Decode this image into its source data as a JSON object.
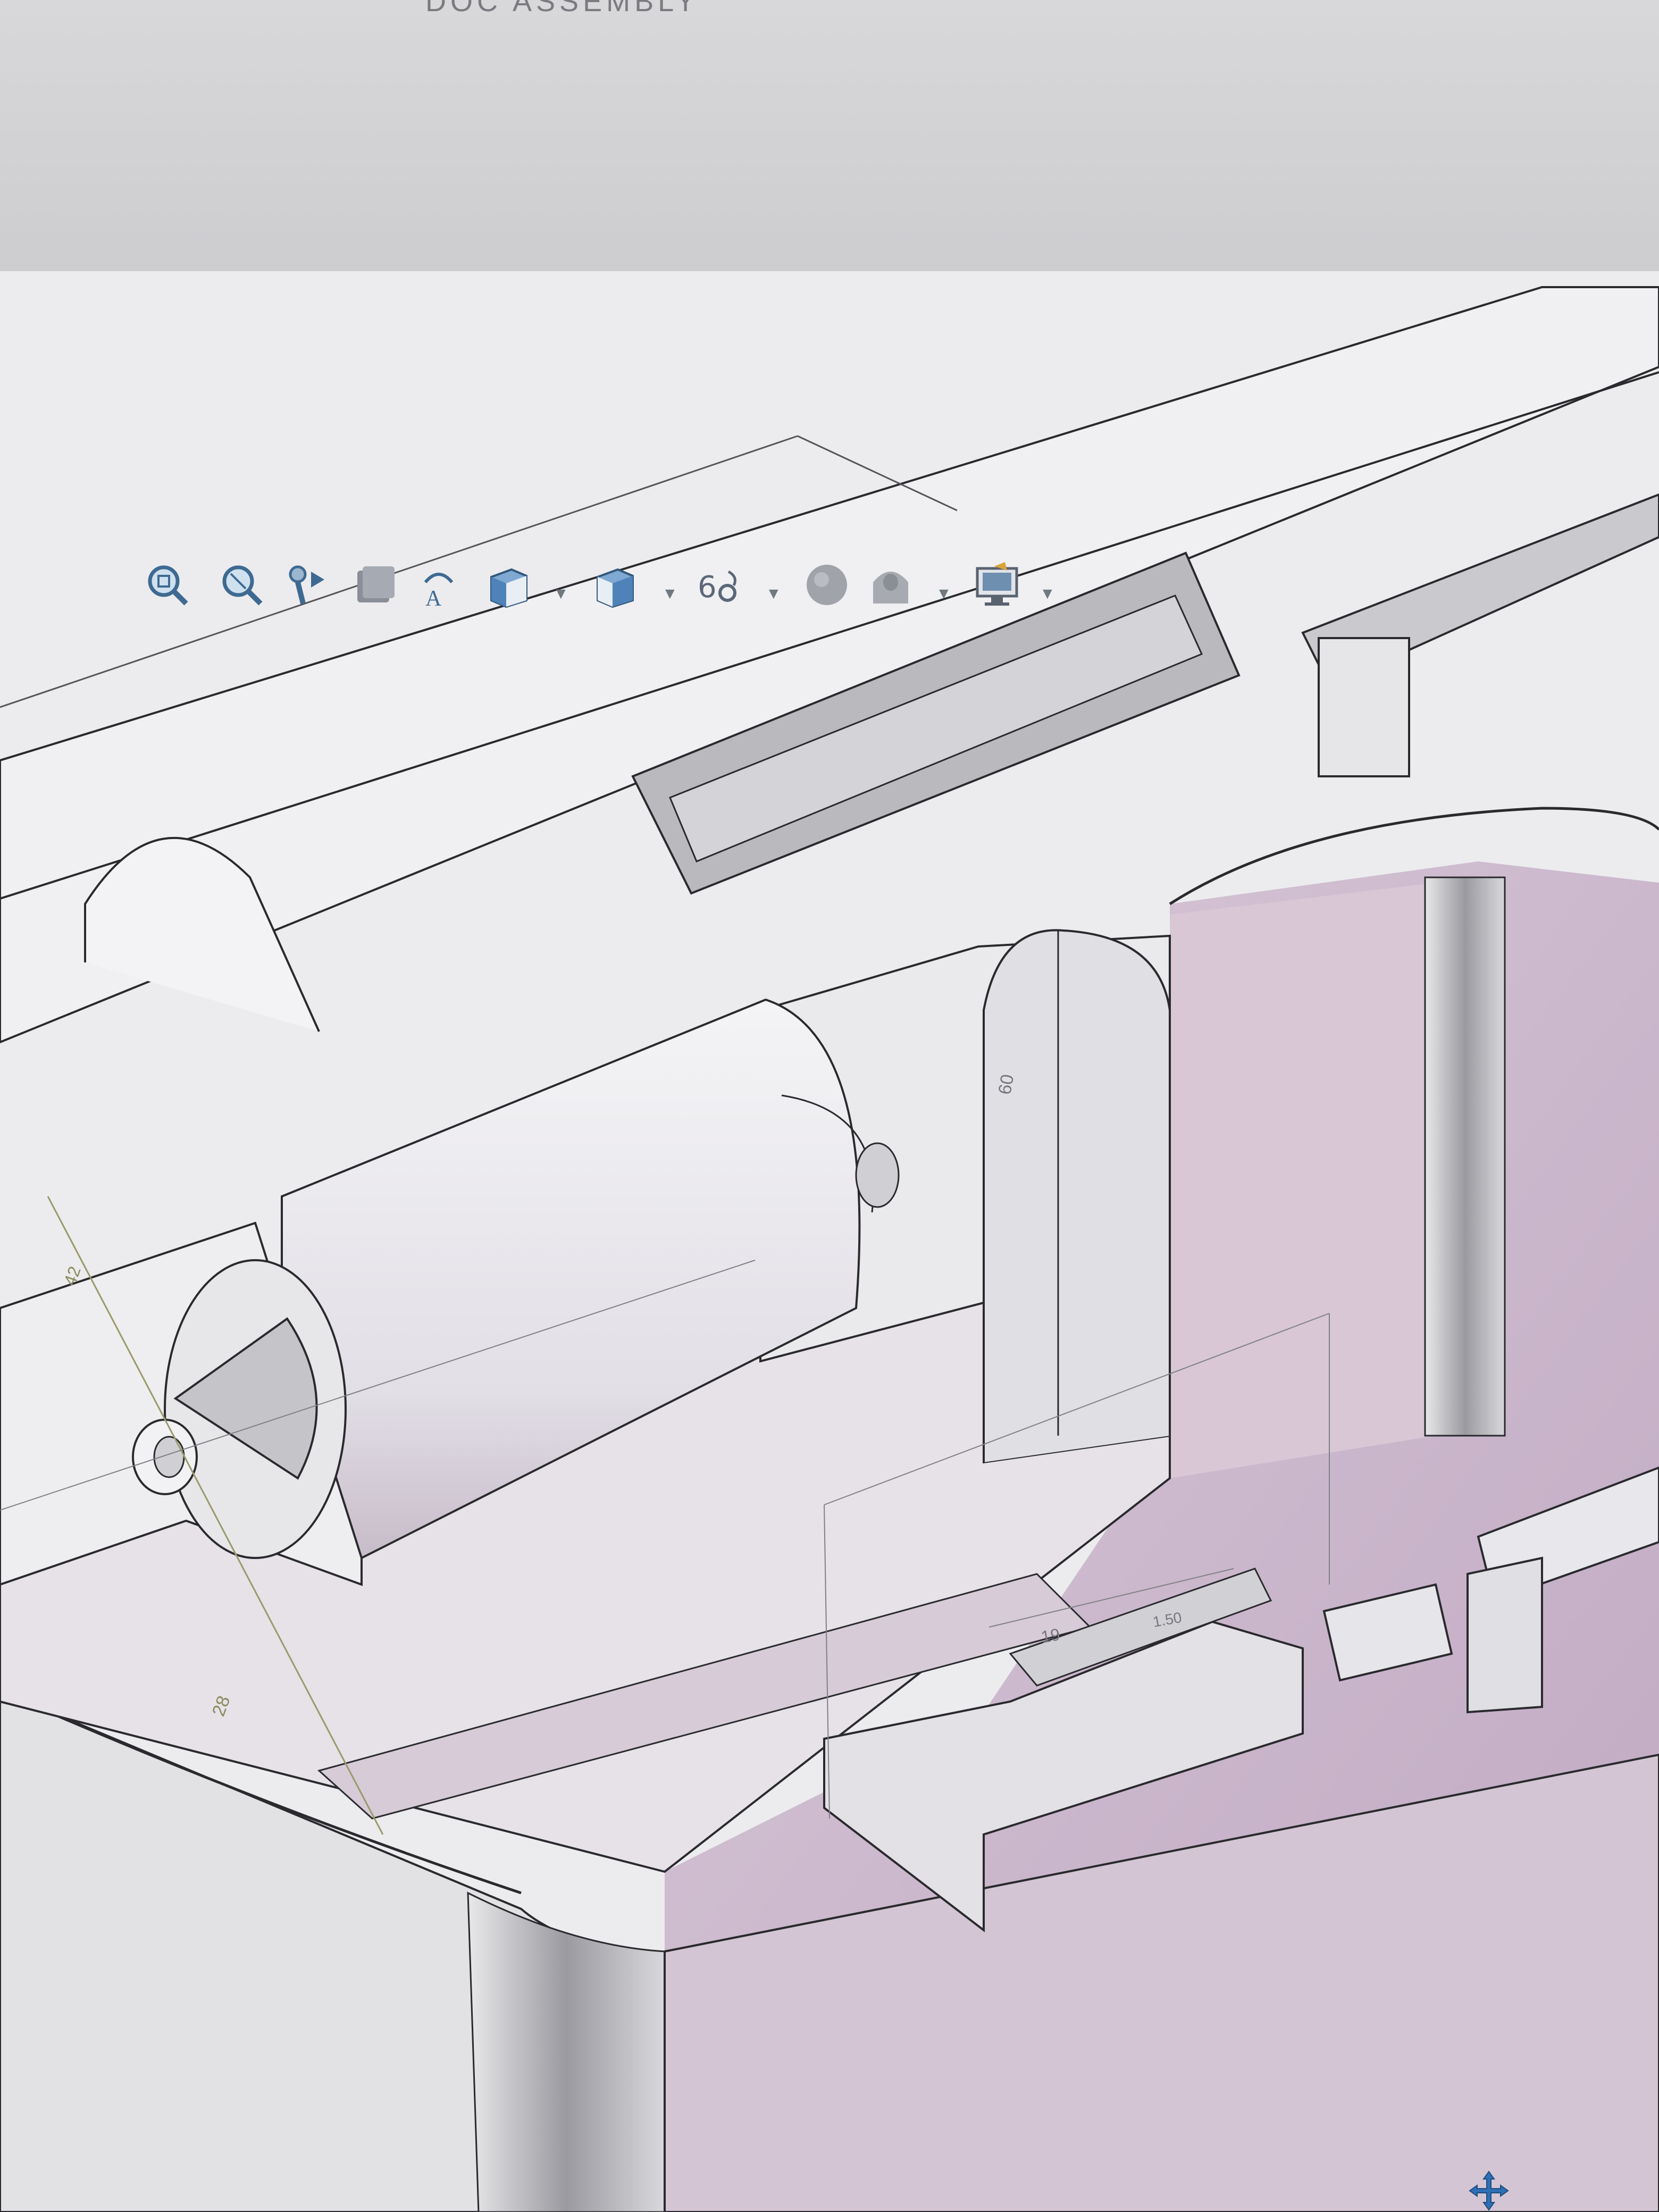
{
  "window": {
    "title": "DOC ASSEMBLY"
  },
  "toolbar": {
    "items": [
      "zoom-to-fit-icon",
      "zoom-to-area-icon",
      "previous-view-icon",
      "section-view-icon",
      "dynamic-annotation-icon",
      "view-orientation-icon",
      "display-style-icon",
      "hide-show-items-icon",
      "edit-appearance-icon",
      "apply-scene-icon",
      "view-settings-icon"
    ]
  },
  "dimensions": {
    "d1": "60",
    "d2": "42",
    "d3": "28",
    "d4": "19",
    "d5": "1.50"
  },
  "colors": {
    "viewport_bg": "#e9e9ec",
    "edge": "#2a2a2e",
    "cavity": "#cbb6cc",
    "dimension_line": "#9a9a6a"
  }
}
